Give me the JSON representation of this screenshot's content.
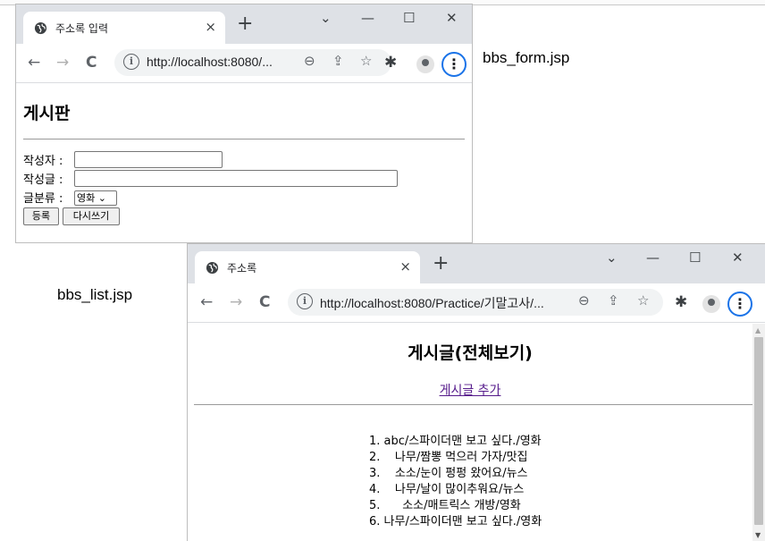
{
  "captions": {
    "form": "bbs_form.jsp",
    "list": "bbs_list.jsp"
  },
  "window_form": {
    "tab_title": "주소록 입력",
    "tab_close": "×",
    "new_tab": "+",
    "controls": {
      "dropdown": "⌄",
      "minimize": "—",
      "maximize": "☐",
      "close": "✕"
    },
    "url": "http://localhost:8080/...",
    "page": {
      "heading": "게시판",
      "author_label": "작성자 :",
      "author_value": "",
      "content_label": "작성글 :",
      "content_value": "",
      "category_label": "글분류 :",
      "category_selected": "영화",
      "submit_label": "등록",
      "reset_label": "다시쓰기"
    }
  },
  "window_list": {
    "tab_title": "주소록",
    "tab_close": "×",
    "new_tab": "+",
    "controls": {
      "dropdown": "⌄",
      "minimize": "—",
      "maximize": "☐",
      "close": "✕"
    },
    "url": "http://localhost:8080/Practice/기말고사/...",
    "page": {
      "heading": "게시글(전체보기)",
      "add_link": "게시글 추가",
      "posts": [
        "1. abc/스파이더맨 보고 싶다./영화",
        "2.    나무/짬뽕 먹으러 가자/맛집",
        "3.    소소/눈이 펑펑 왔어요/뉴스",
        "4.    나무/날이 많이추워요/뉴스",
        "5.      소소/매트릭스 개방/영화",
        "6. 나무/스파이더맨 보고 싶다./영화"
      ]
    }
  },
  "colors": {
    "tab_strip": "#dee1e6",
    "profile_ring": "#1a73e8",
    "visited_link": "#551a8b"
  }
}
